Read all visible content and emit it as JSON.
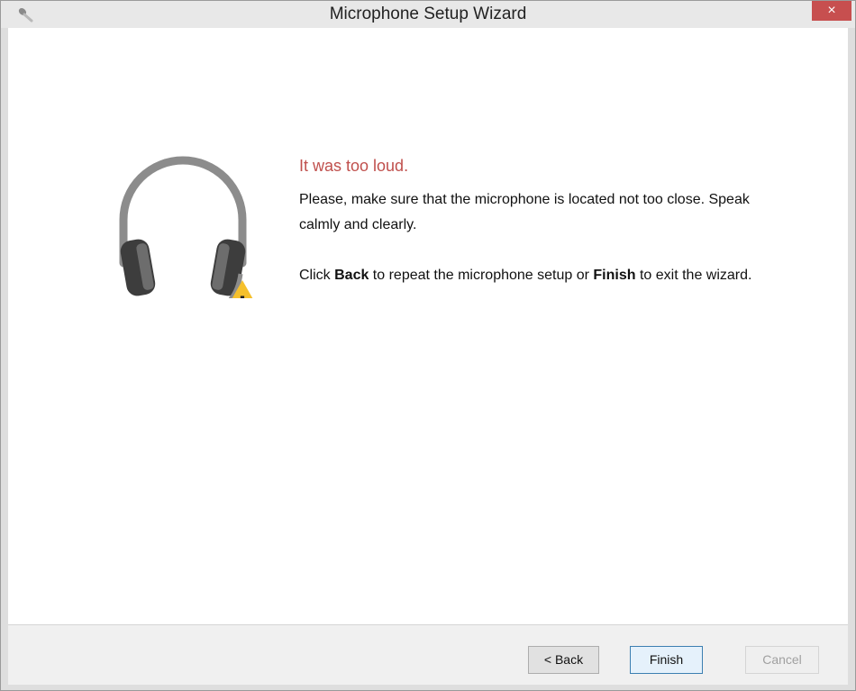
{
  "window": {
    "title": "Microphone Setup Wizard",
    "close_glyph": "×",
    "icon": "microphone-icon",
    "close_color": "#c74f4f"
  },
  "message": {
    "heading": "It was too loud.",
    "heading_color": "#c0504d",
    "line1": "Please, make sure that the microphone is located not too close. Speak calmly and clearly.",
    "line2_pre": "Click ",
    "line2_back": "Back",
    "line2_mid": " to repeat the microphone setup or ",
    "line2_finish": "Finish",
    "line2_post": " to exit the wizard."
  },
  "illustration": {
    "icon": "headset-warning-icon",
    "warning_glyph": "!"
  },
  "buttons": {
    "back": "< Back",
    "finish": "Finish",
    "cancel": "Cancel"
  }
}
